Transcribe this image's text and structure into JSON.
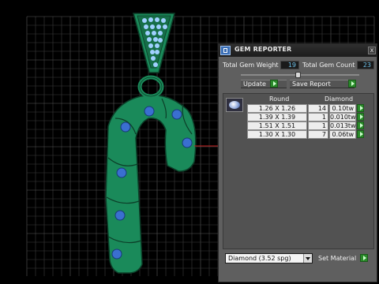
{
  "window": {
    "title": "GEM REPORTER",
    "close_glyph": "x",
    "app_icon": "gem-reporter-icon"
  },
  "summary": {
    "total_gem_weight_label": "Total Gem Weight",
    "total_gem_weight_value": "19",
    "total_gem_count_label": "Total Gem Count",
    "total_gem_count_value": "23"
  },
  "actions": {
    "update_label": "Update",
    "save_report_label": "Save Report"
  },
  "table": {
    "shape_header": "Round",
    "material_header": "Diamond",
    "rows": [
      {
        "size": "1.26 X 1.26",
        "count": "14",
        "weight": "0.10tw"
      },
      {
        "size": "1.39 X 1.39",
        "count": "1",
        "weight": "0.010tw"
      },
      {
        "size": "1.51 X 1.51",
        "count": "1",
        "weight": "0.013tw"
      },
      {
        "size": "1.30 X 1.30",
        "count": "7",
        "weight": "0.06tw"
      }
    ]
  },
  "material": {
    "selected": "Diamond   (3.52 spg)",
    "set_material_label": "Set Material"
  },
  "colors": {
    "model_green": "#1a8a5a",
    "gem_blue": "#3a6fd0",
    "accent_green": "#2a8a2a",
    "value_blue": "#6ec0e8"
  }
}
